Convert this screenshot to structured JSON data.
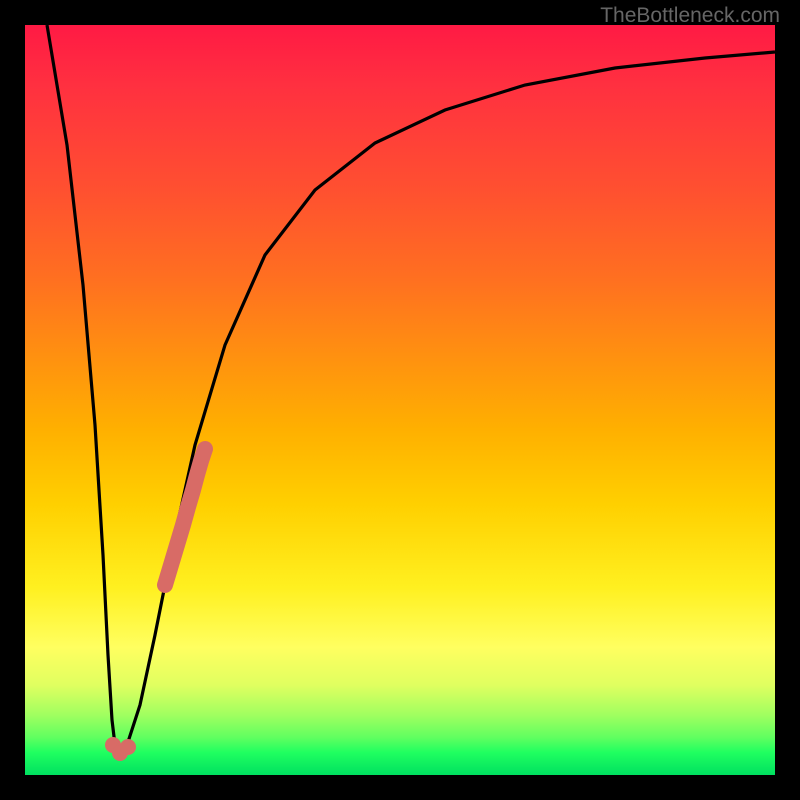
{
  "watermark": "TheBottleneck.com",
  "colors": {
    "background": "#000000",
    "curve": "#000000",
    "highlight": "#d86b66",
    "gradient_top": "#ff1a44",
    "gradient_bottom": "#00e060"
  },
  "chart_data": {
    "type": "line",
    "title": "",
    "xlabel": "",
    "ylabel": "",
    "xlim": [
      0,
      100
    ],
    "ylim": [
      0,
      100
    ],
    "series": [
      {
        "name": "bottleneck-curve",
        "x": [
          3,
          5,
          7,
          9,
          10,
          11,
          12,
          13,
          15,
          17,
          20,
          25,
          30,
          40,
          50,
          60,
          70,
          80,
          90,
          100
        ],
        "values": [
          100,
          78,
          55,
          30,
          15,
          5,
          3,
          8,
          20,
          35,
          50,
          64,
          73,
          82,
          87,
          90,
          92.5,
          94,
          95,
          96
        ]
      }
    ],
    "highlight_segments": [
      {
        "name": "highlight-near-min",
        "points_x": [
          10.5,
          11,
          11.8
        ],
        "points_y": [
          7,
          4,
          5
        ]
      },
      {
        "name": "highlight-rising",
        "points_x": [
          17,
          18,
          19,
          20,
          20.8,
          21.5,
          22,
          22.5,
          23
        ],
        "points_y": [
          22,
          25,
          28,
          31,
          34,
          37,
          39,
          41,
          43
        ]
      }
    ]
  }
}
